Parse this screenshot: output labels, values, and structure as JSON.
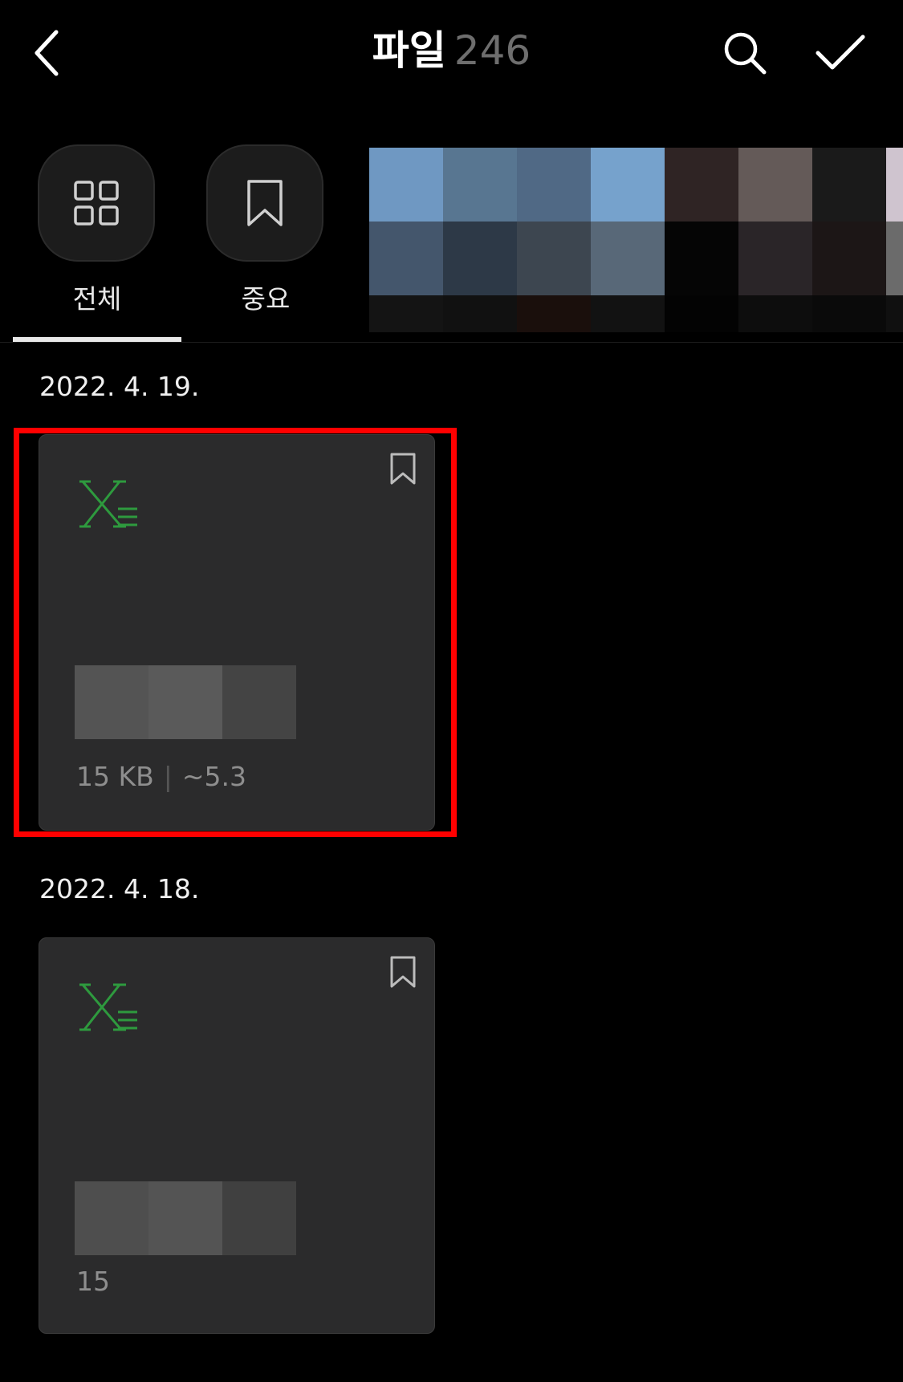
{
  "header": {
    "title": "파일",
    "count": "246"
  },
  "filters": {
    "all_label": "전체",
    "important_label": "중요",
    "selected": "all"
  },
  "groups": [
    {
      "date": "2022. 4. 19.",
      "file": {
        "type_icon": "excel-file-icon",
        "size": "15 KB",
        "info": "~5.3"
      }
    },
    {
      "date": "2022. 4. 18.",
      "file": {
        "type_icon": "excel-file-icon",
        "size": "15",
        "info": ""
      }
    }
  ],
  "colors": {
    "background": "#000000",
    "card": "#2b2b2c",
    "excel_green": "#2e9a3e",
    "highlight": "#ff0000"
  }
}
